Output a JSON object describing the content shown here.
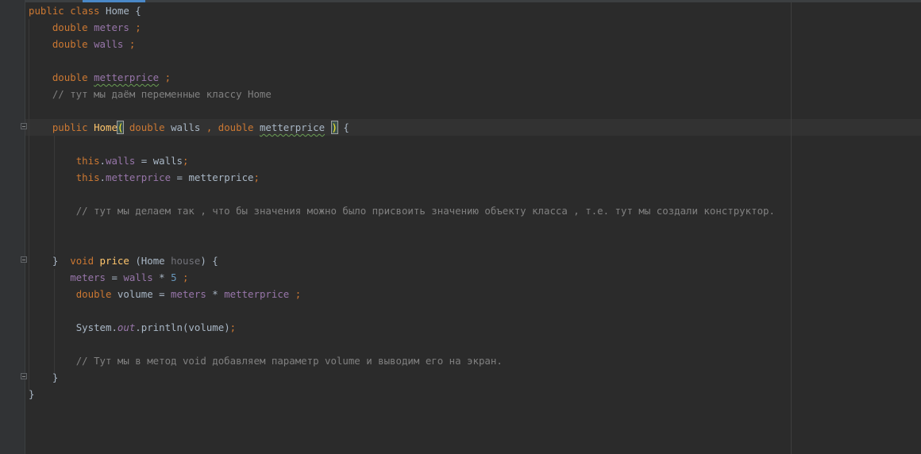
{
  "editor": {
    "theme": {
      "background": "#2b2b2b",
      "keyword": "#cc7832",
      "field": "#9876aa",
      "comment": "#808080",
      "number": "#6897bb",
      "method": "#ffc66d",
      "text": "#a9b7c6"
    },
    "lines": [
      {
        "indent": "",
        "tokens": [
          {
            "t": "kw",
            "v": "public class "
          },
          {
            "t": "txt",
            "v": "Home {"
          }
        ]
      },
      {
        "indent": "    ",
        "tokens": [
          {
            "t": "kw",
            "v": "double "
          },
          {
            "t": "fld",
            "v": "meters"
          },
          {
            "t": "kw",
            "v": " ;"
          }
        ]
      },
      {
        "indent": "    ",
        "tokens": [
          {
            "t": "kw",
            "v": "double "
          },
          {
            "t": "fld",
            "v": "walls"
          },
          {
            "t": "kw",
            "v": " ;"
          }
        ]
      },
      {
        "indent": "",
        "tokens": []
      },
      {
        "indent": "    ",
        "tokens": [
          {
            "t": "kw",
            "v": "double "
          },
          {
            "t": "fld typo",
            "v": "metterprice"
          },
          {
            "t": "kw",
            "v": " ;"
          }
        ]
      },
      {
        "indent": "    ",
        "tokens": [
          {
            "t": "cmt",
            "v": "// тут мы даём переменные классу Home"
          }
        ]
      },
      {
        "indent": "",
        "tokens": []
      },
      {
        "indent": "    ",
        "tokens": [
          {
            "t": "kw",
            "v": "public "
          },
          {
            "t": "fn",
            "v": "Home"
          },
          {
            "t": "brace-match",
            "v": "("
          },
          {
            "t": "txt",
            "v": " "
          },
          {
            "t": "kw",
            "v": "double "
          },
          {
            "t": "txt",
            "v": "walls "
          },
          {
            "t": "kw",
            "v": ", double "
          },
          {
            "t": "txt typo",
            "v": "metterprice"
          },
          {
            "t": "txt",
            "v": " "
          },
          {
            "t": "brace-match",
            "v": ")"
          },
          {
            "t": "txt",
            "v": " {"
          }
        ]
      },
      {
        "indent": "",
        "tokens": []
      },
      {
        "indent": "        ",
        "tokens": [
          {
            "t": "kw",
            "v": "this"
          },
          {
            "t": "txt",
            "v": "."
          },
          {
            "t": "fld",
            "v": "walls"
          },
          {
            "t": "txt",
            "v": " = walls"
          },
          {
            "t": "kw",
            "v": ";"
          }
        ]
      },
      {
        "indent": "        ",
        "tokens": [
          {
            "t": "kw",
            "v": "this"
          },
          {
            "t": "txt",
            "v": "."
          },
          {
            "t": "fld",
            "v": "metterprice"
          },
          {
            "t": "txt",
            "v": " = metterprice"
          },
          {
            "t": "kw",
            "v": ";"
          }
        ]
      },
      {
        "indent": "",
        "tokens": []
      },
      {
        "indent": "        ",
        "tokens": [
          {
            "t": "cmt",
            "v": "// тут мы делаем так , что бы значения можно было присвоить значению объекту класса , т.е. тут мы создали конструктор."
          }
        ]
      },
      {
        "indent": "",
        "tokens": []
      },
      {
        "indent": "",
        "tokens": []
      },
      {
        "indent": "    ",
        "tokens": [
          {
            "t": "txt",
            "v": "}  "
          },
          {
            "t": "kw",
            "v": "void "
          },
          {
            "t": "fn",
            "v": "price"
          },
          {
            "t": "txt",
            "v": " (Home "
          },
          {
            "t": "grey",
            "v": "house"
          },
          {
            "t": "txt",
            "v": ") {"
          }
        ]
      },
      {
        "indent": "       ",
        "tokens": [
          {
            "t": "fld",
            "v": "meters"
          },
          {
            "t": "txt",
            "v": " = "
          },
          {
            "t": "fld",
            "v": "walls"
          },
          {
            "t": "txt",
            "v": " * "
          },
          {
            "t": "num",
            "v": "5"
          },
          {
            "t": "kw",
            "v": " ;"
          }
        ]
      },
      {
        "indent": "        ",
        "tokens": [
          {
            "t": "kw",
            "v": "double "
          },
          {
            "t": "txt",
            "v": "volume = "
          },
          {
            "t": "fld",
            "v": "meters"
          },
          {
            "t": "txt",
            "v": " * "
          },
          {
            "t": "fld",
            "v": "metterprice"
          },
          {
            "t": "kw",
            "v": " ;"
          }
        ]
      },
      {
        "indent": "",
        "tokens": []
      },
      {
        "indent": "        ",
        "tokens": [
          {
            "t": "txt",
            "v": "System."
          },
          {
            "t": "fld it",
            "v": "out"
          },
          {
            "t": "txt",
            "v": ".println(volume)"
          },
          {
            "t": "kw",
            "v": ";"
          }
        ]
      },
      {
        "indent": "",
        "tokens": []
      },
      {
        "indent": "        ",
        "tokens": [
          {
            "t": "cmt",
            "v": "// Тут мы в метод void добавляем параметр volume и выводим его на экран."
          }
        ]
      },
      {
        "indent": "    ",
        "tokens": [
          {
            "t": "txt",
            "v": "}"
          }
        ]
      },
      {
        "indent": "",
        "tokens": [
          {
            "t": "txt",
            "v": "}"
          }
        ]
      }
    ]
  }
}
